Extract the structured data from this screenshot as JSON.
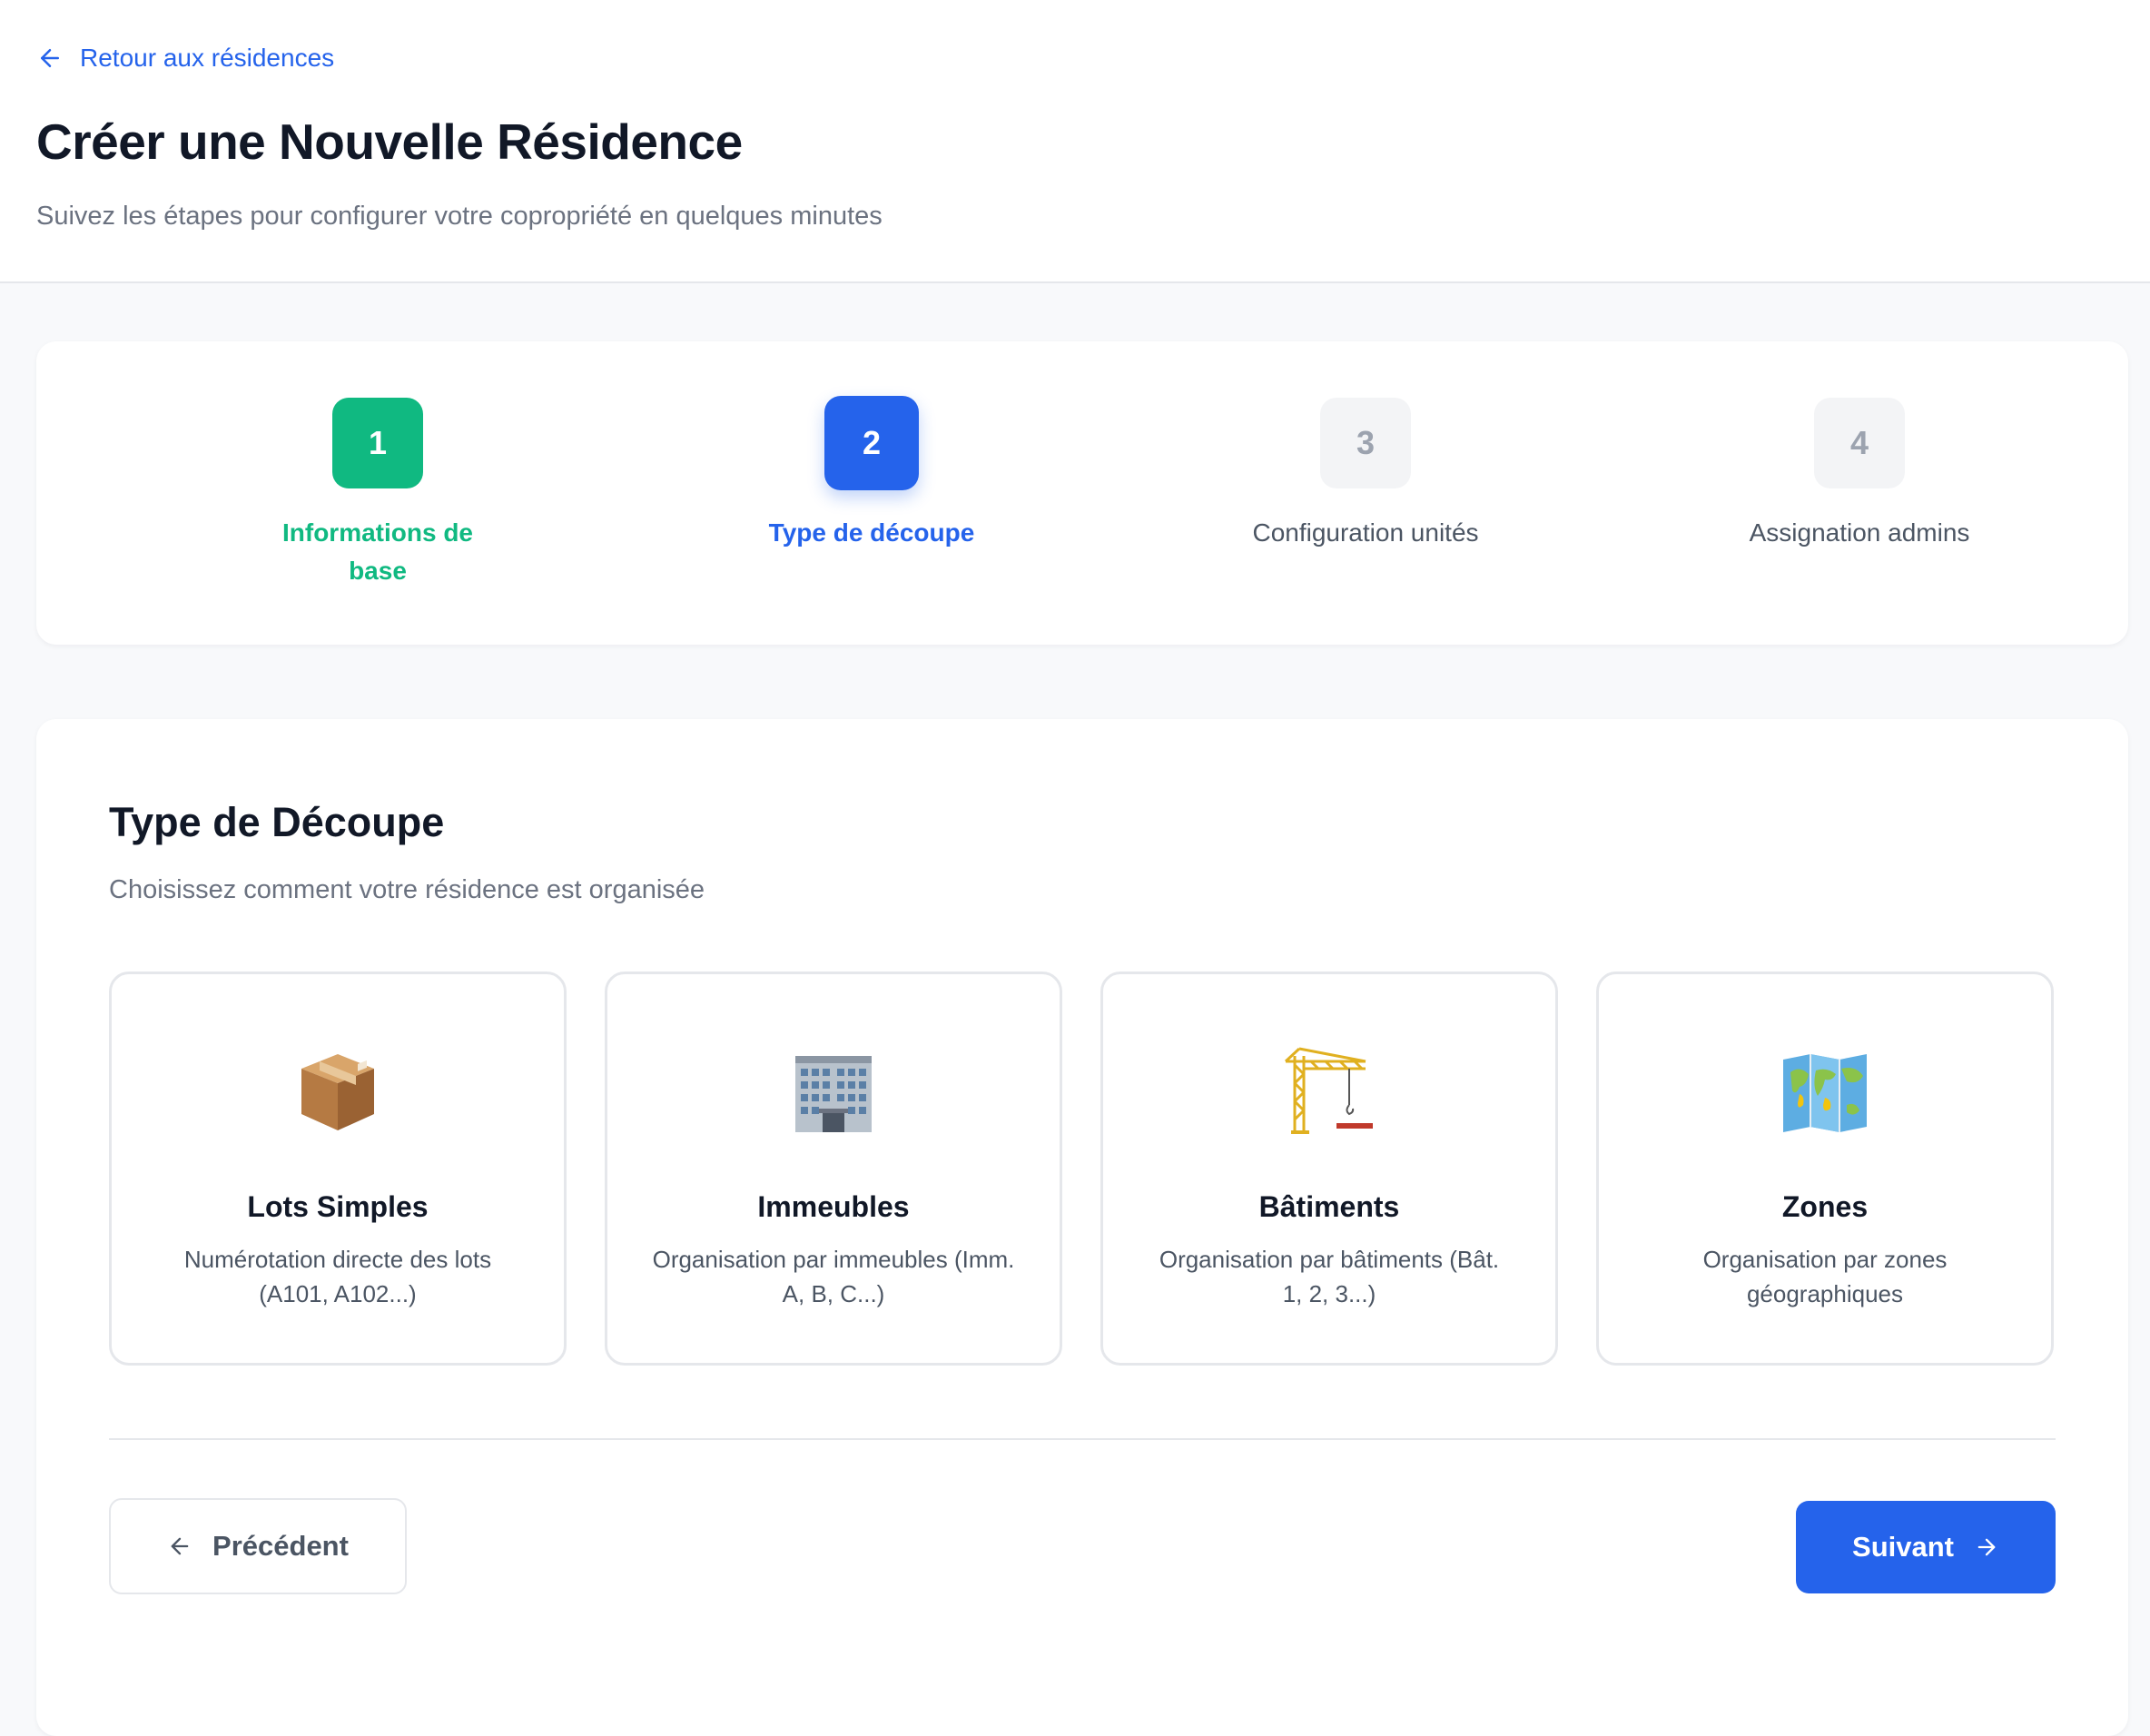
{
  "header": {
    "back_link": "Retour aux résidences",
    "title": "Créer une Nouvelle Résidence",
    "subtitle": "Suivez les étapes pour configurer votre copropriété en quelques minutes"
  },
  "stepper": {
    "steps": [
      {
        "number": "1",
        "label": "Informations de base",
        "state": "done"
      },
      {
        "number": "2",
        "label": "Type de découpe",
        "state": "active"
      },
      {
        "number": "3",
        "label": "Configuration unités",
        "state": "todo"
      },
      {
        "number": "4",
        "label": "Assignation admins",
        "state": "todo"
      }
    ]
  },
  "section": {
    "title": "Type de Découpe",
    "subtitle": "Choisissez comment votre résidence est organisée"
  },
  "options": [
    {
      "icon": "package-box-icon",
      "title": "Lots Simples",
      "description": "Numérotation directe des lots (A101, A102...)"
    },
    {
      "icon": "office-building-icon",
      "title": "Immeubles",
      "description": "Organisation par immeubles (Imm. A, B, C...)"
    },
    {
      "icon": "construction-crane-icon",
      "title": "Bâtiments",
      "description": "Organisation par bâtiments (Bât. 1, 2, 3...)"
    },
    {
      "icon": "world-map-icon",
      "title": "Zones",
      "description": "Organisation par zones géographiques"
    }
  ],
  "actions": {
    "previous_label": "Précédent",
    "next_label": "Suivant"
  },
  "colors": {
    "primary": "#2563eb",
    "success": "#10b981",
    "muted": "#9ca3af",
    "border": "#e5e7eb"
  }
}
